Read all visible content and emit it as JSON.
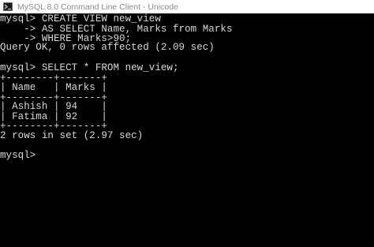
{
  "window": {
    "title": "MySQL 8.0 Command Line Client - Unicode",
    "icon": "mysql-console-icon"
  },
  "console": {
    "lines": [
      "mysql> CREATE VIEW new_view",
      "    -> AS SELECT Name, Marks from Marks",
      "    -> WHERE Marks>90;",
      "Query OK, 0 rows affected (2.09 sec)",
      "",
      "mysql> SELECT * FROM new_view;",
      "+--------+-------+",
      "| Name   | Marks |",
      "+--------+-------+",
      "| Ashish | 94    |",
      "| Fatima | 92    |",
      "+--------+-------+",
      "2 rows in set (2.97 sec)",
      "",
      "mysql>"
    ]
  },
  "colors": {
    "background": "#000000",
    "text": "#d9d9d9",
    "titlebar": "#ffffff",
    "title_text": "#8a8a8a"
  }
}
